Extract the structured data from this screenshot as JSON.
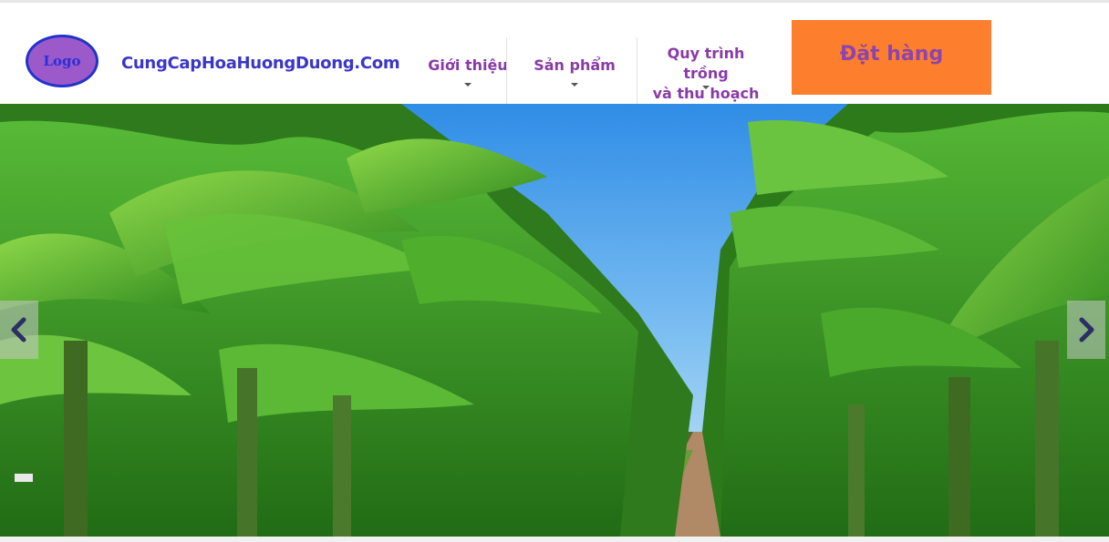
{
  "header": {
    "logo_text": "Logo",
    "site_name": "CungCapHoaHuongDuong.Com",
    "nav": [
      {
        "label": "Giới thiệu"
      },
      {
        "label": "Sản phẩm"
      },
      {
        "label_line1": "Quy trình trồng",
        "label_line2": "và thu hoạch"
      }
    ],
    "order_button": "Đặt hàng"
  },
  "hero": {
    "image": "banana-plantation-photo",
    "prev_icon": "chevron-left-icon",
    "next_icon": "chevron-right-icon"
  },
  "colors": {
    "accent_orange": "#fd7f2d",
    "nav_purple": "#8a3aa8",
    "site_name_blue": "#3a36c8"
  }
}
